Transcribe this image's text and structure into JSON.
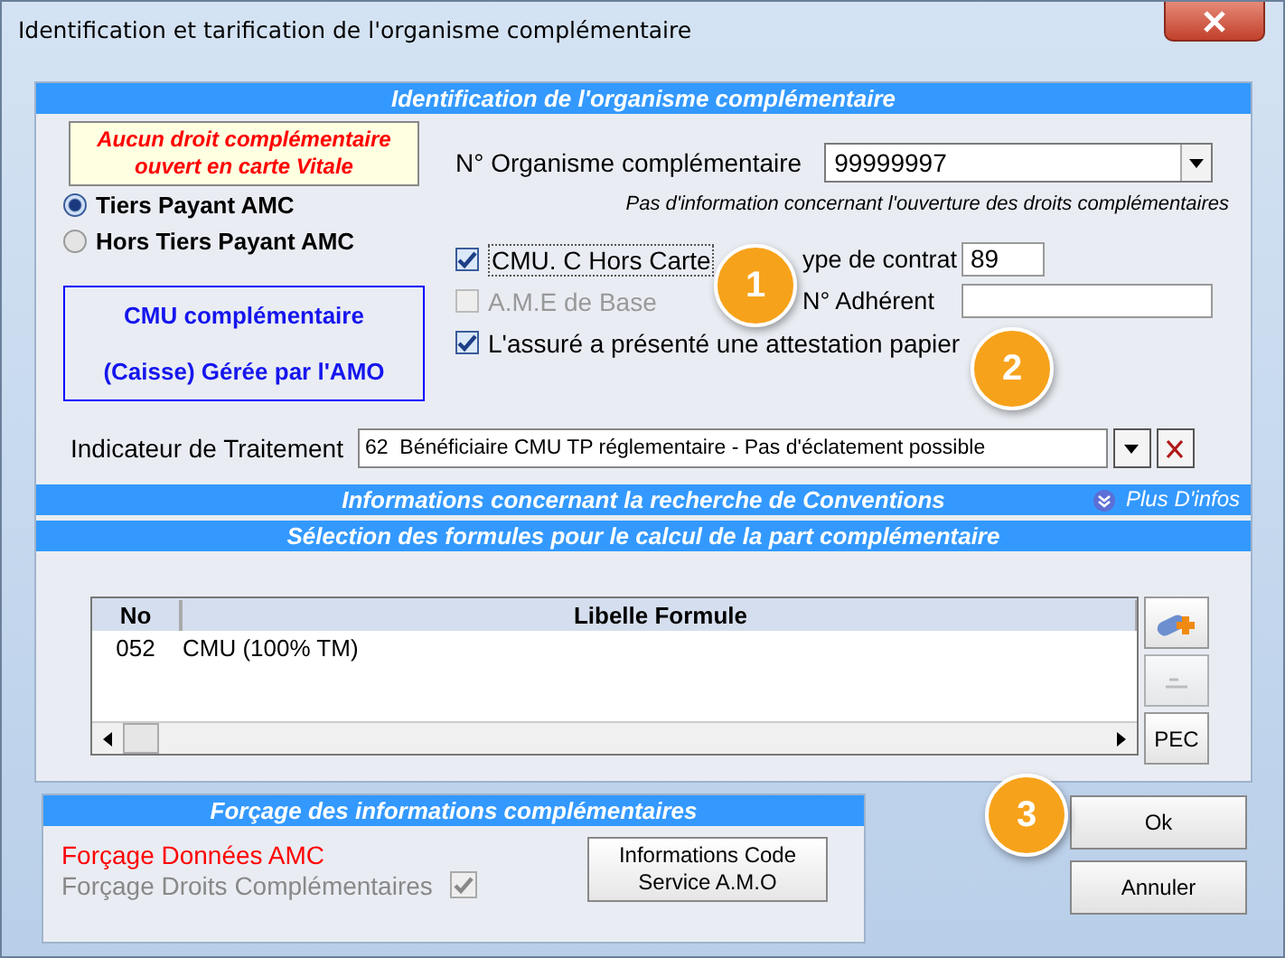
{
  "window": {
    "title": "Identification et tarification de l'organisme complémentaire"
  },
  "identification": {
    "header": "Identification de l'organisme complémentaire",
    "warning": "Aucun droit complémentaire ouvert en carte Vitale",
    "payment_options": [
      {
        "label": "Tiers Payant AMC",
        "selected": true
      },
      {
        "label": "Hors Tiers Payant AMC",
        "selected": false
      }
    ],
    "cmu_box": [
      "CMU complémentaire",
      "(Caisse) Gérée par l'AMO"
    ],
    "organisme": {
      "label": "N° Organisme complémentaire",
      "value": "99999997"
    },
    "info_note": "Pas d'information concernant l'ouverture des droits complémentaires",
    "checkboxes": [
      {
        "label": "CMU. C Hors Carte",
        "checked": true,
        "disabled": false
      },
      {
        "label": "A.M.E de Base",
        "checked": false,
        "disabled": true
      },
      {
        "label": "L'assuré a présenté une attestation papier",
        "checked": true,
        "disabled": false
      }
    ],
    "contract_type": {
      "label": "ype de contrat",
      "value": "89"
    },
    "adherent": {
      "label": "N° Adhérent"
    },
    "treatment": {
      "label": "Indicateur de Traitement",
      "value": "62  Bénéficiaire CMU TP réglementaire - Pas d'éclatement possible"
    }
  },
  "conventions": {
    "header": "Informations concernant la recherche de Conventions",
    "more_link": "Plus D'infos"
  },
  "formulas": {
    "header": "Sélection des formules pour le calcul de la part complémentaire",
    "table": {
      "columns": [
        "No",
        "Libelle Formule"
      ],
      "rows": [
        [
          "052",
          "CMU (100% TM)"
        ]
      ]
    },
    "side_buttons": [
      {
        "kind": "add",
        "disabled": false
      },
      {
        "kind": "remove",
        "disabled": true
      },
      {
        "kind": "text",
        "label": "PEC",
        "disabled": false
      }
    ]
  },
  "forcing": {
    "header": "Forçage des informations  complémentaires",
    "items": [
      {
        "kind": "alert",
        "label": "Forçage Données AMC"
      },
      {
        "kind": "checkbox",
        "label": "Forçage Droits Complémentaires",
        "checked": true
      }
    ],
    "button": "Informations Code Service A.M.O"
  },
  "buttons": [
    "Ok",
    "Annuler"
  ],
  "callouts": [
    "1",
    "2",
    "3"
  ]
}
